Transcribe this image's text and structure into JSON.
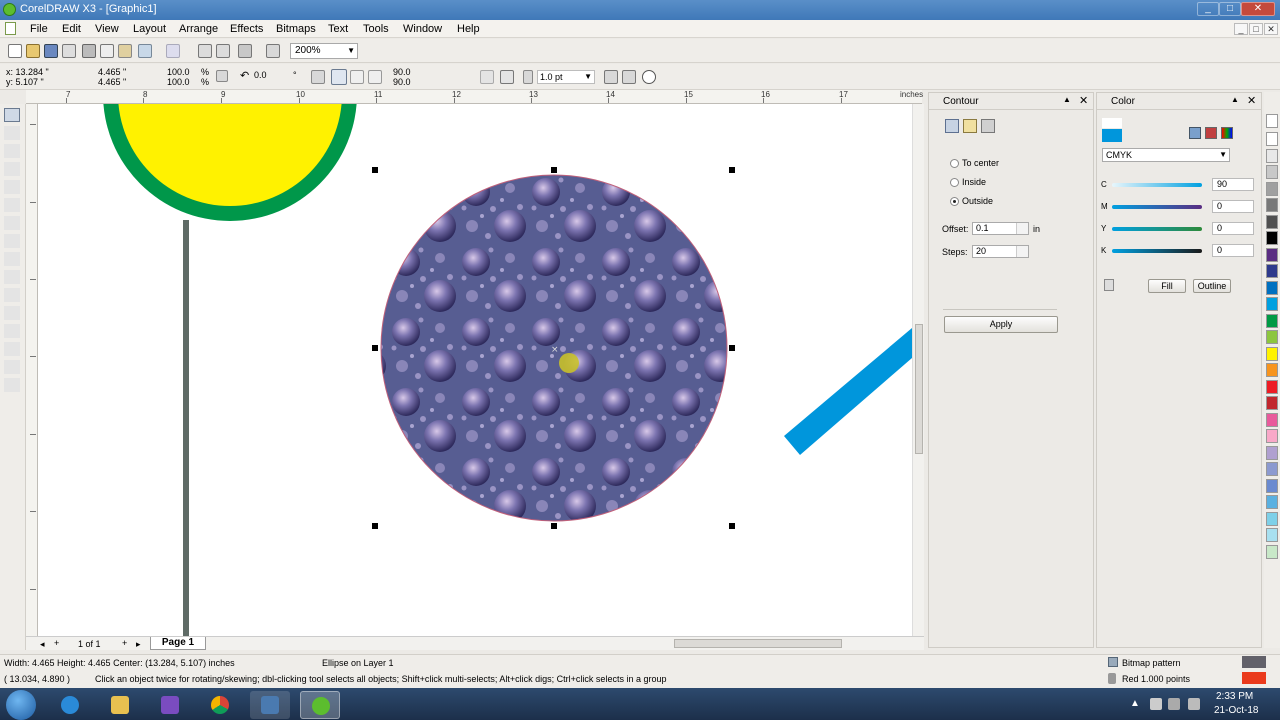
{
  "window": {
    "title": "CorelDRAW X3 - [Graphic1]",
    "controls": [
      "_",
      "□",
      "✕"
    ]
  },
  "menu": [
    "File",
    "Edit",
    "View",
    "Layout",
    "Arrange",
    "Effects",
    "Bitmaps",
    "Text",
    "Tools",
    "Window",
    "Help"
  ],
  "toolbar": {
    "zoom": "200%"
  },
  "propertybar": {
    "x": "x: 13.284 \"",
    "y": "y: 5.107 \"",
    "width": "4.465 \"",
    "height": "4.465 \"",
    "scale_w": "100.0",
    "scale_h": "100.0",
    "percent": "%",
    "rotation": "0.0",
    "degree": "°",
    "angle_start": "90.0",
    "angle_end": "90.0",
    "outline_width": "1.0 pt"
  },
  "ruler": {
    "h_ticks": [
      "7",
      "8",
      "9",
      "10",
      "11",
      "12",
      "13",
      "14",
      "15",
      "16",
      "17"
    ],
    "unit": "inches"
  },
  "contour": {
    "title": "Contour",
    "options": [
      {
        "label": "To center",
        "selected": false
      },
      {
        "label": "Inside",
        "selected": false
      },
      {
        "label": "Outside",
        "selected": true
      }
    ],
    "offset_label": "Offset:",
    "offset_value": "0.1",
    "offset_unit": "in",
    "steps_label": "Steps:",
    "steps_value": "20",
    "apply_label": "Apply"
  },
  "color": {
    "title": "Color",
    "model": "CMYK",
    "channels": [
      {
        "label": "C",
        "value": "90",
        "color": "#00a0e0"
      },
      {
        "label": "M",
        "value": "0",
        "color": "#5a2d82"
      },
      {
        "label": "Y",
        "value": "0",
        "color": "#2e8a3a"
      },
      {
        "label": "K",
        "value": "0",
        "color": "#1a1a1a"
      }
    ],
    "fill_label": "Fill",
    "outline_label": "Outline",
    "swatch_color": "#0096dc"
  },
  "pages": {
    "counter": "1 of 1",
    "tab": "Page 1"
  },
  "status": {
    "dimensions": "Width: 4.465  Height: 4.465  Center: (13.284, 5.107)  inches",
    "object": "Ellipse on Layer 1",
    "cursor": "( 13.034, 4.890 )",
    "hint": "Click an object twice for rotating/skewing; dbl-clicking tool selects all objects; Shift+click multi-selects; Alt+click digs; Ctrl+click selects in a group",
    "fill": "Bitmap pattern",
    "outline": "Red  1.000 points"
  },
  "taskbar": {
    "time": "2:33 PM",
    "date": "21-Oct-18"
  },
  "palette_colors": [
    "#ffffff",
    "#e8e8e8",
    "#c8c8c8",
    "#a0a0a0",
    "#787878",
    "#505050",
    "#000000",
    "#5a2d82",
    "#2e3a8c",
    "#0070c0",
    "#00a0e0",
    "#009a44",
    "#8dc63f",
    "#fff200",
    "#f7941d",
    "#ed1c24",
    "#c1272d",
    "#e85a9b",
    "#f9a8c8",
    "#b0a0d0",
    "#8c9ad0",
    "#6a8ad0",
    "#5ab0e0",
    "#7ed0e8",
    "#a8e0f0",
    "#c8e8c8"
  ]
}
